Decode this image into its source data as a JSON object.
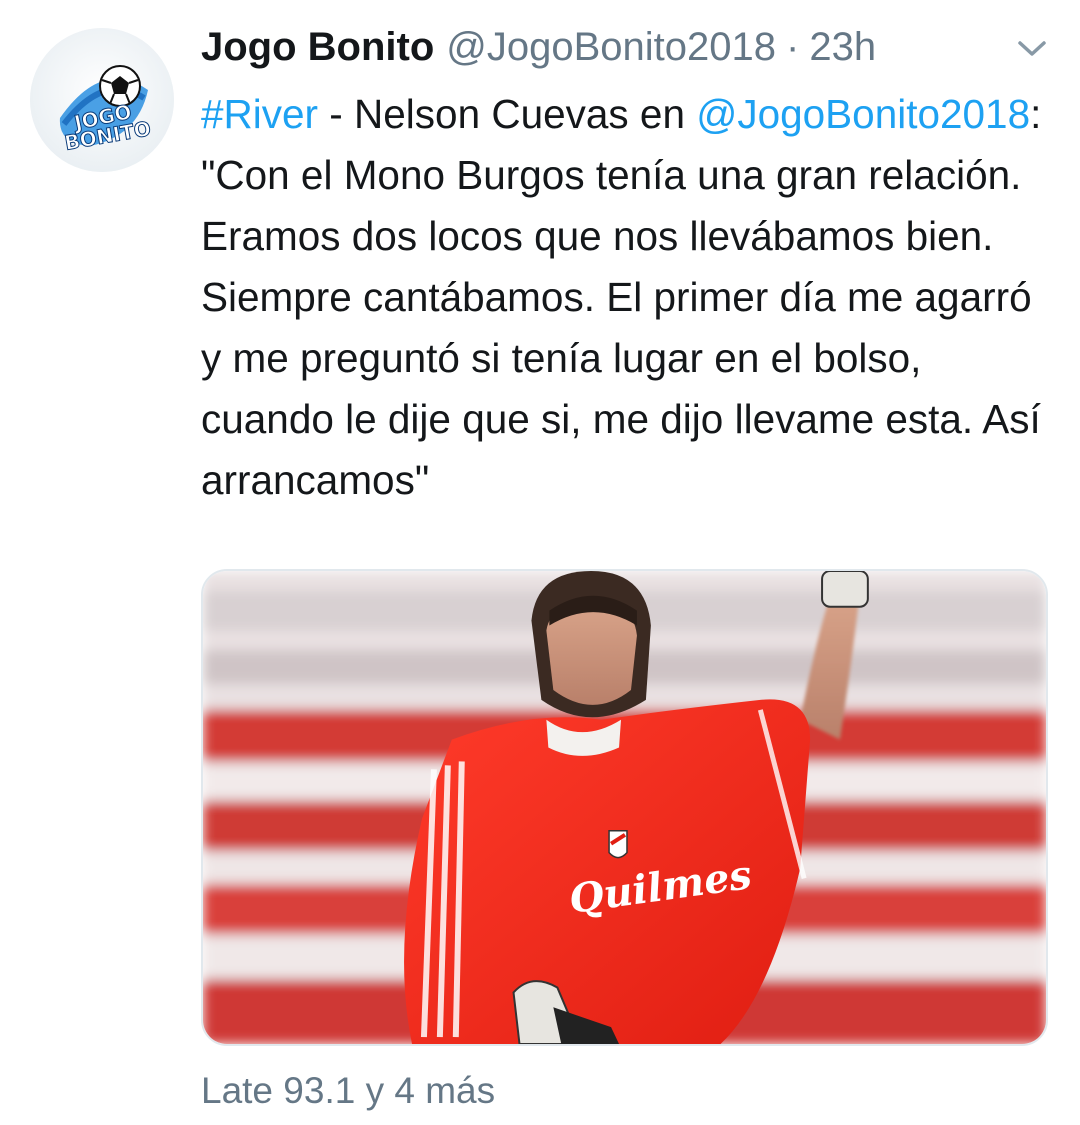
{
  "tweet": {
    "display_name": "Jogo Bonito",
    "handle": "@JogoBonito2018",
    "separator": "·",
    "time": "23h",
    "text": {
      "hashtag": "#River",
      "part1": " - Nelson Cuevas en ",
      "mention": "@JogoBonito2018",
      "part2": ": \"Con el Mono Burgos tenía una gran relación. Eramos dos locos que nos llevábamos bien. Siempre cantábamos. El primer día me agarró y me preguntó si tenía lugar en el bolso, cuando le dije que si, me dijo llevame esta. Así arrancamos\""
    },
    "avatar_logo_text": [
      "JOGO",
      "BONITO"
    ],
    "jersey_sponsor": "Quilmes",
    "footer": "Late 93.1 y 4 más"
  },
  "colors": {
    "link": "#1da1f2",
    "secondary_text": "#657786",
    "primary_text": "#14171a"
  },
  "icons": {
    "menu": "chevron-down-icon"
  }
}
